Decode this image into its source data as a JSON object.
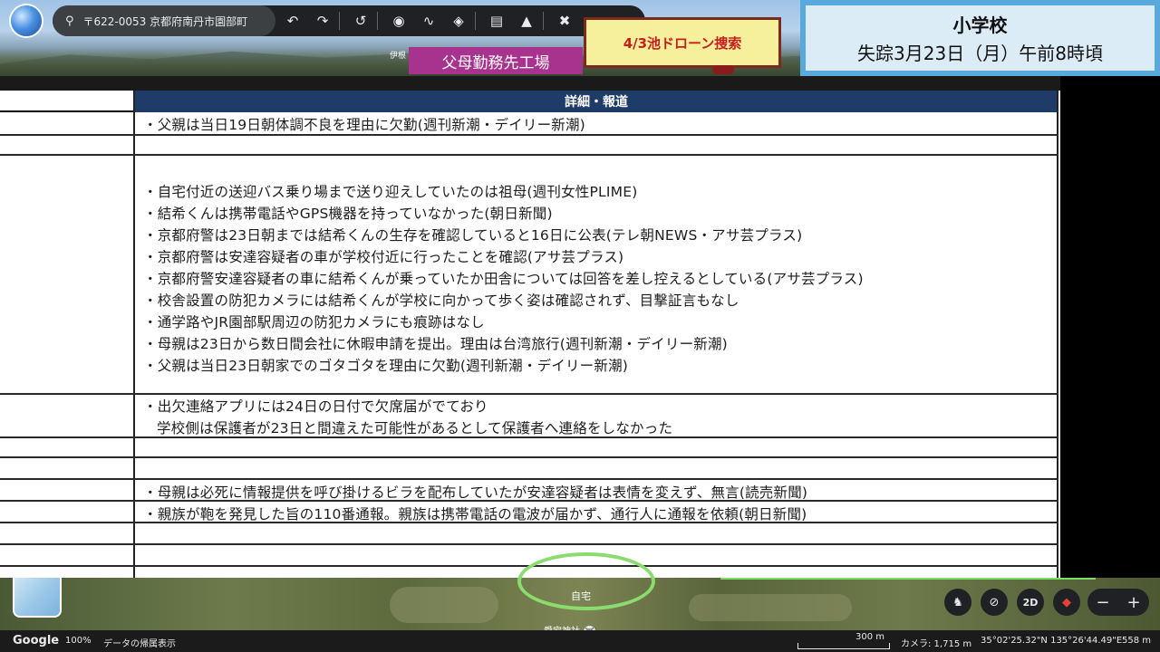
{
  "toolbar": {
    "search_value": "〒622-0053 京都府南丹市園部町",
    "icons": [
      "search-icon",
      "undo-icon",
      "redo-icon",
      "history-icon",
      "placemark-icon",
      "path-icon",
      "layers-icon",
      "ruler-icon",
      "image-overlay-icon",
      "tools-icon"
    ]
  },
  "map_labels": {
    "place_tag": "伊根",
    "factory": "父母勤務先工場",
    "drone": "4/3池ドローン捜索",
    "home": "自宅",
    "shrine": "愛宕神社"
  },
  "school": {
    "title": "小学校",
    "subtitle": "失踪3月23日（月）午前8時頃"
  },
  "table": {
    "header": "詳細・報道",
    "row1": [
      "・父親は当日19日朝体調不良を理由に欠勤(週刊新潮・デイリー新潮)"
    ],
    "row2": [
      "・自宅付近の送迎バス乗り場まで送り迎えしていたのは祖母(週刊女性PLIME)",
      "・結希くんは携帯電話やGPS機器を持っていなかった(朝日新聞)",
      "・京都府警は23日朝までは結希くんの生存を確認していると16日に公表(テレ朝NEWS・アサ芸プラス)",
      "・京都府警は安達容疑者の車が学校付近に行ったことを確認(アサ芸プラス)",
      "・京都府警安達容疑者の車に結希くんが乗っていたか田舎については回答を差し控えるとしている(アサ芸プラス)",
      "・校舎設置の防犯カメラには結希くんが学校に向かって歩く姿は確認されず、目撃証言もなし",
      "・通学路やJR園部駅周辺の防犯カメラにも痕跡はなし",
      "・母親は23日から数日間会社に休暇申請を提出。理由は台湾旅行(週刊新潮・デイリー新潮)",
      "・父親は当日23日朝家でのゴタゴタを理由に欠勤(週刊新潮・デイリー新潮)"
    ],
    "row3_line1": "・出欠連絡アプリには24日の日付で欠席届がでており",
    "row3_line2": "学校側は保護者が23日と間違えた可能性があるとして保護者へ連絡をしなかった",
    "row4": "・母親は必死に情報提供を呼び掛けるビラを配布していたが安達容疑者は表情を変えず、無言(読売新聞)",
    "row5": "・親族が鞄を発見した旨の110番通報。親族は携帯電話の電波が届かず、通行人に通報を依頼(朝日新聞)"
  },
  "map_controls": {
    "mode_2d": "2D",
    "zoom_out": "−",
    "zoom_in": "+"
  },
  "status": {
    "logo": "Google",
    "zoom": "100%",
    "attribution": "データの帰属表示",
    "scale": "300 m",
    "camera": "カメラ: 1,715 m",
    "coords": "35°02'25.32\"N 135°26'44.49\"E",
    "elevation": "558 m"
  }
}
